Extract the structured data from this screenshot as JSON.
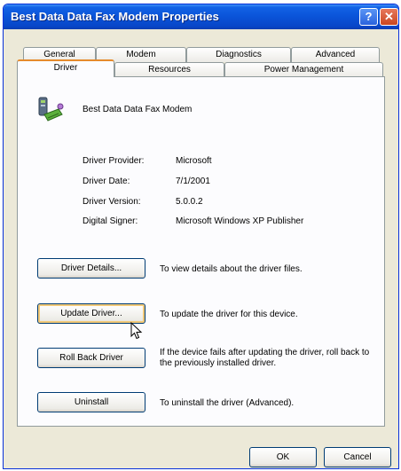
{
  "window": {
    "title": "Best Data Data Fax Modem Properties",
    "help_glyph": "?",
    "close_glyph": "✕"
  },
  "tabs": {
    "row1": [
      "General",
      "Modem",
      "Diagnostics",
      "Advanced"
    ],
    "row2": [
      "Driver",
      "Resources",
      "Power Management"
    ],
    "active": "Driver"
  },
  "device": {
    "icon": "modem-device-icon",
    "name": "Best Data Data Fax Modem"
  },
  "driver_info": [
    {
      "label": "Driver Provider:",
      "value": "Microsoft"
    },
    {
      "label": "Driver Date:",
      "value": "7/1/2001"
    },
    {
      "label": "Driver Version:",
      "value": "5.0.0.2"
    },
    {
      "label": "Digital Signer:",
      "value": "Microsoft Windows XP Publisher"
    }
  ],
  "actions": [
    {
      "button": "Driver Details...",
      "description": "To view details about the driver files."
    },
    {
      "button": "Update Driver...",
      "description": "To update the driver for this device."
    },
    {
      "button": "Roll Back Driver",
      "description": "If the device fails after updating the driver, roll back to the previously installed driver."
    },
    {
      "button": "Uninstall",
      "description": "To uninstall the driver (Advanced)."
    }
  ],
  "footer": {
    "ok_label": "OK",
    "cancel_label": "Cancel"
  },
  "colors": {
    "titlebar": "#0a53d8",
    "dialog_bg": "#ece9d8",
    "panel_bg": "#fcfcfe",
    "active_tab_accent": "#e68b2c",
    "button_border": "#003c74"
  }
}
